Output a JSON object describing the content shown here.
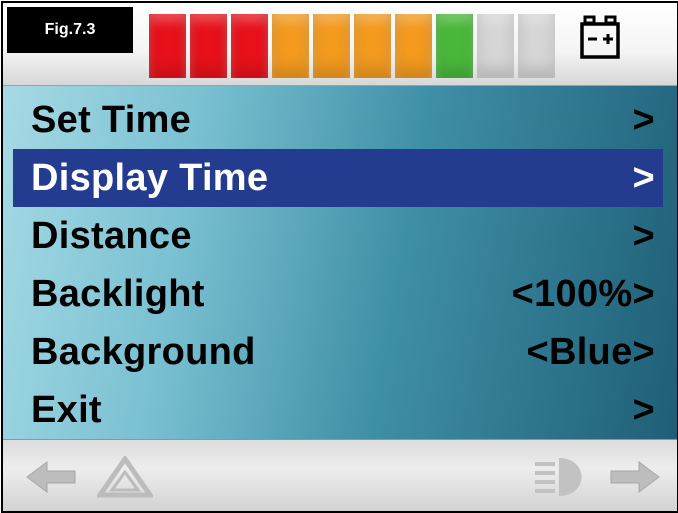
{
  "figure_label": "Fig.7.3",
  "battery": {
    "segment_colors": [
      "#e8111b",
      "#e8111b",
      "#e8111b",
      "#f39a1f",
      "#f39a1f",
      "#f39a1f",
      "#f39a1f",
      "#49b83a",
      "#d6d6d6",
      "#d6d6d6"
    ],
    "icon": "battery-icon"
  },
  "menu": {
    "items": [
      {
        "label": "Set Time",
        "value": ">",
        "selected": false
      },
      {
        "label": "Display Time",
        "value": ">",
        "selected": true
      },
      {
        "label": "Distance",
        "value": ">",
        "selected": false
      },
      {
        "label": "Backlight",
        "value": "<100%>",
        "selected": false
      },
      {
        "label": "Background",
        "value": "<Blue>",
        "selected": false
      },
      {
        "label": "Exit",
        "value": ">",
        "selected": false
      }
    ]
  },
  "bottom_bar": {
    "icons": [
      "left-arrow-icon",
      "hazard-warning-icon",
      "headlight-icon",
      "right-arrow-icon"
    ]
  }
}
